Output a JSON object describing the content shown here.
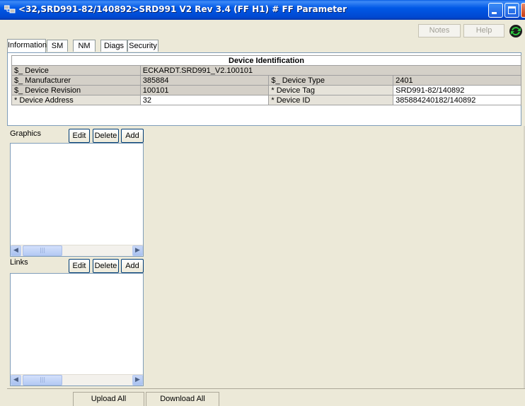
{
  "window": {
    "title": "<32,SRD991-82/140892>SRD991 V2 Rev 3.4 (FF H1) # FF Parameter",
    "icon": "app-icon",
    "controls": [
      "minimize-icon",
      "maximize-icon",
      "close-icon"
    ]
  },
  "toolbar": {
    "notes_label": "Notes",
    "help_label": "Help",
    "refresh_icon": "refresh-icon"
  },
  "tabs": [
    {
      "label": "Information",
      "active": true
    },
    {
      "label": "SM",
      "active": false
    },
    {
      "label": "NM",
      "active": false
    },
    {
      "label": "Diags",
      "active": false
    },
    {
      "label": "Security",
      "active": false
    }
  ],
  "device_identification": {
    "header": "Device Identification",
    "device_label": "$_ Device",
    "device_value": "ECKARDT.SRD991_V2.100101",
    "manufacturer_label": "$_ Manufacturer",
    "manufacturer_value": "385884",
    "device_type_label": "$_ Device Type",
    "device_type_value": "2401",
    "device_revision_label": "$_ Device Revision",
    "device_revision_value": "100101",
    "device_tag_label": "* Device Tag",
    "device_tag_value": "SRD991-82/140892",
    "device_address_label": "* Device Address",
    "device_address_value": "32",
    "device_id_label": "* Device ID",
    "device_id_value": "385884240182/140892"
  },
  "graphics": {
    "label": "Graphics",
    "edit_label": "Edit",
    "delete_label": "Delete",
    "add_label": "Add"
  },
  "links": {
    "label": "Links",
    "edit_label": "Edit",
    "delete_label": "Delete",
    "add_label": "Add"
  },
  "bottom": {
    "upload_label": "Upload All",
    "download_label": "Download All"
  },
  "colors": {
    "titlebar": "#0054e3",
    "window_bg": "#ece9d8",
    "table_gray": "#d4d0c8",
    "table_light": "#e6e3da"
  }
}
